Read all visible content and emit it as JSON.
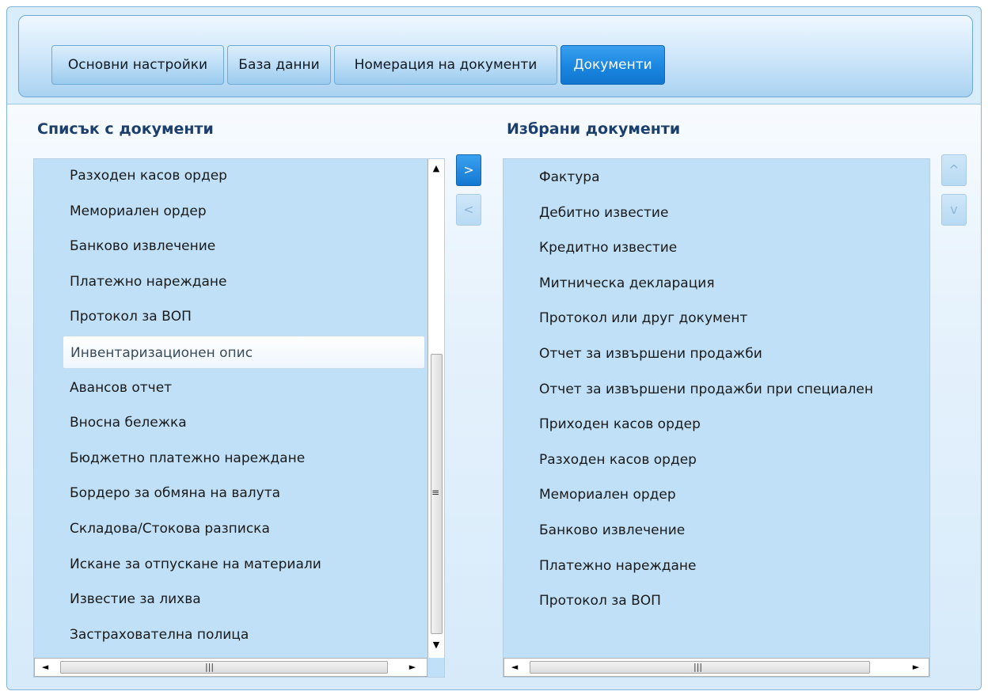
{
  "tabs": [
    {
      "label": "Основни настройки",
      "active": false
    },
    {
      "label": "База данни",
      "active": false
    },
    {
      "label": "Номерация на документи",
      "active": false
    },
    {
      "label": "Документи",
      "active": true
    }
  ],
  "left_panel": {
    "title": "Списък с документи",
    "items": [
      "Разходен касов ордер",
      "Мемориален ордер",
      "Банково извлечение",
      "Платежно нареждане",
      "Протокол за ВОП",
      "Инвентаризационен опис",
      "Авансов отчет",
      "Вносна бележка",
      "Бюджетно платежно нареждане",
      "Бордеро за обмяна на валута",
      "Складова/Стокова разписка",
      "Искане за отпускане на материали",
      "Известие за лихва",
      "Застрахователна полица"
    ],
    "hovered_item": "Инвентаризационен опис"
  },
  "right_panel": {
    "title": "Избрани документи",
    "items": [
      "Фактура",
      "Дебитно известие",
      "Кредитно известие",
      "Митническа декларация",
      "Протокол или друг документ",
      "Отчет за извършени продажби",
      "Отчет за извършени продажби при специален",
      "Приходен касов ордер",
      "Разходен касов ордер",
      "Мемориален ордер",
      "Банково извлечение",
      "Платежно нареждане",
      "Протокол за ВОП"
    ]
  },
  "buttons": {
    "add": ">",
    "remove": "<",
    "move_up": "^",
    "move_down": "v",
    "add_enabled": true,
    "remove_enabled": false,
    "move_up_enabled": false,
    "move_down_enabled": false
  },
  "scroll_glyphs": {
    "up": "▲",
    "down": "▼",
    "left": "◄",
    "right": "►",
    "grip": "≡",
    "hgrip": "|||"
  },
  "icons": {
    "scroll_up": "up-arrow-icon",
    "scroll_down": "down-arrow-icon",
    "scroll_left": "left-arrow-icon",
    "scroll_right": "right-arrow-icon"
  },
  "colors": {
    "accent": "#1a86e0",
    "panel_bg": "#bfe0f7",
    "title": "#1c3f6e"
  }
}
